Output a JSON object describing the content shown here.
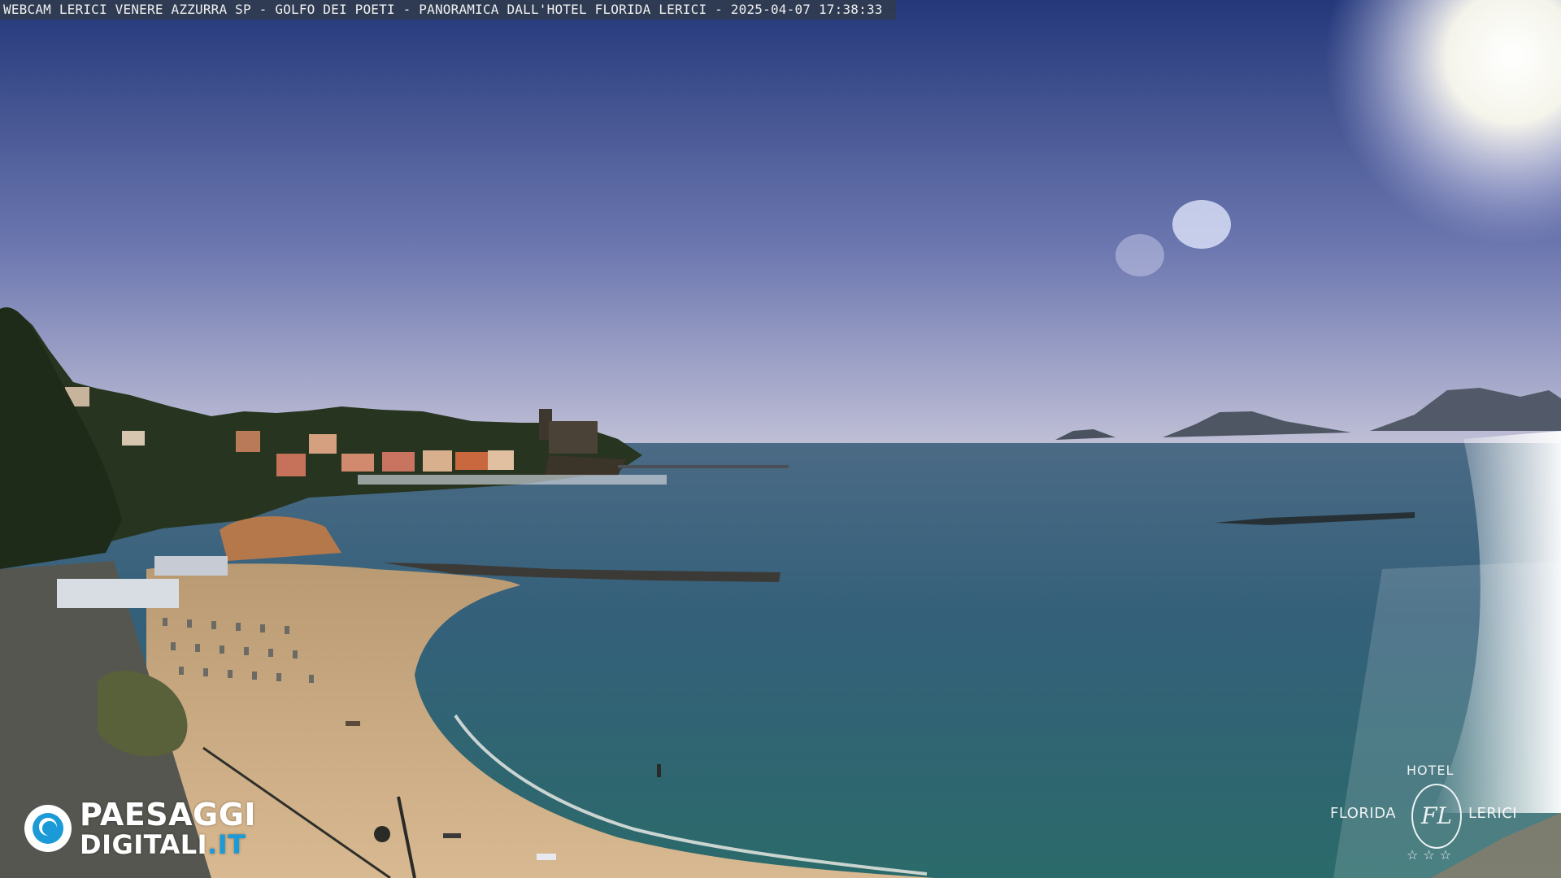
{
  "caption": "WEBCAM LERICI VENERE AZZURRA SP - GOLFO DEI POETI - PANORAMICA DALL'HOTEL FLORIDA LERICI - 2025-04-07 17:38:33",
  "logo_left": {
    "line1": "PAESAGGI",
    "line2_main": "DIGITALI",
    "line2_domain": ".IT"
  },
  "logo_right": {
    "hotel": "HOTEL",
    "florida": "FLORIDA",
    "lerici": "LERICI",
    "monogram": "FL",
    "stars": "☆☆☆"
  },
  "colors": {
    "sky_top": "#253a78",
    "sky_horizon": "#b7bcd6",
    "sea_far": "#3e5f7a",
    "sea_near": "#2f6d72",
    "sand": "#c9a982",
    "hills": "#1f2d1e",
    "islands": "#4a5360",
    "brand_blue": "#1a9ad6"
  }
}
